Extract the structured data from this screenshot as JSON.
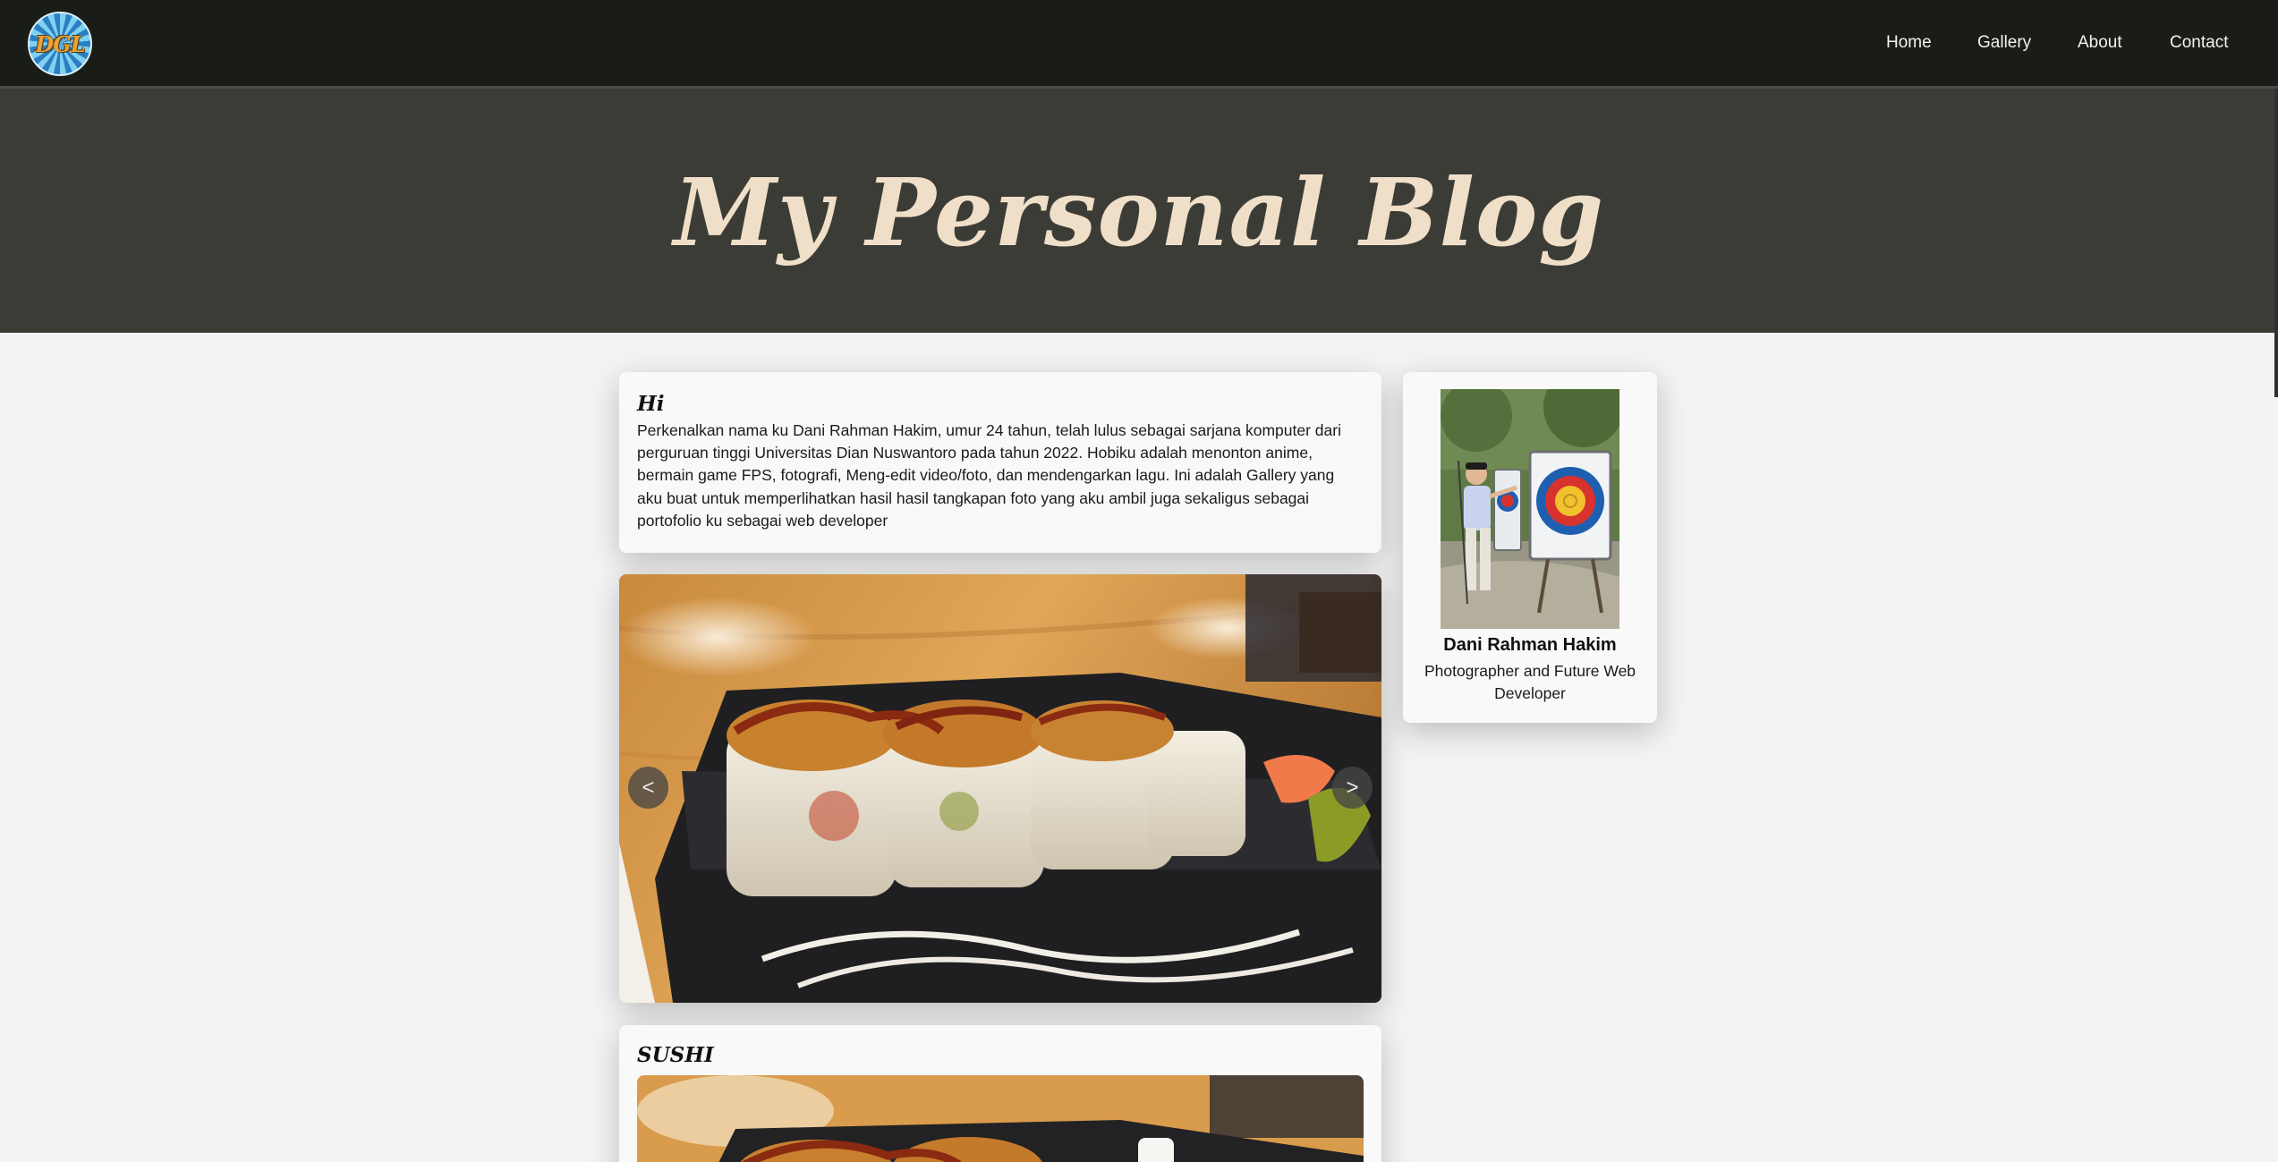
{
  "header": {
    "logo_text": "DGL",
    "nav": [
      {
        "label": "Home"
      },
      {
        "label": "Gallery"
      },
      {
        "label": "About"
      },
      {
        "label": "Contact"
      }
    ]
  },
  "hero": {
    "title": "My Personal Blog"
  },
  "intro": {
    "title": "Hi",
    "text": "Perkenalkan nama ku Dani Rahman Hakim, umur 24 tahun, telah lulus sebagai sarjana komputer dari perguruan tinggi Universitas Dian Nuswantoro pada tahun 2022. Hobiku adalah menonton anime, bermain game FPS, fotografi, Meng-edit video/foto, dan mendengarkan lagu. Ini adalah Gallery yang aku buat untuk memperlihatkan hasil hasil tangkapan foto yang aku ambil juga sekaligus sebagai portofolio ku sebagai web developer"
  },
  "slider": {
    "prev_label": "<",
    "next_label": ">"
  },
  "post": {
    "title": "SUSHI"
  },
  "profile": {
    "name": "Dani Rahman Hakim",
    "role": "Photographer and Future Web Developer"
  },
  "colors": {
    "navbar": "#1a1c17",
    "hero": "#3c3c37",
    "hero_title": "#f0dfc8",
    "page_bg": "#f3f3f3"
  }
}
